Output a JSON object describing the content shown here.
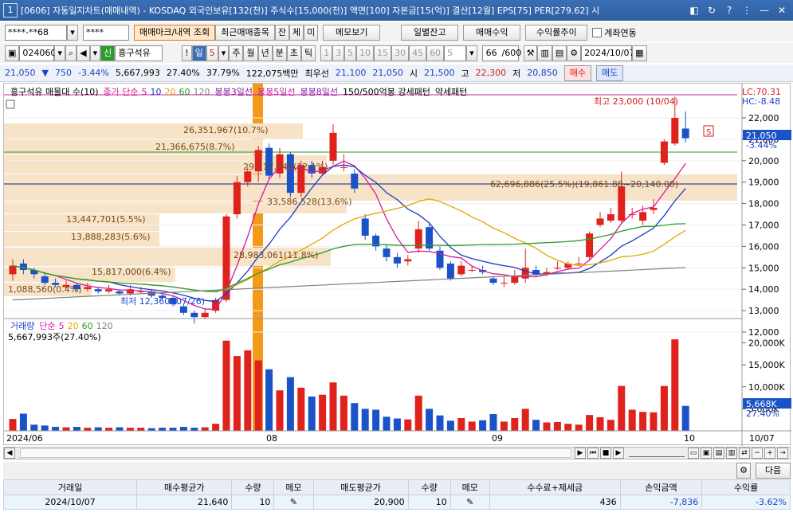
{
  "titlebar": {
    "number": "1",
    "title": "[0606] 자동일지차트(매매내역) - KOSDAQ 외국인보유[132(천)] 주식수[15,000(천)] 액면[100] 자본금[15(억)] 결산[12월] EPS[75] PER[279.62] 시",
    "controls": [
      "◧",
      "↻",
      "?",
      "⋮",
      "—",
      "✕"
    ]
  },
  "toolbar1": {
    "account_value": "****-**68",
    "password_value": "****",
    "btn_trade_marks": "매매마크/내역 조회",
    "btn_recent": "최근매매종목",
    "btn_jan": "잔",
    "btn_che": "체",
    "btn_mi": "미",
    "btn_memo": "메모보기",
    "btn_daily_balance": "일별잔고",
    "btn_trade_profit": "매매수익",
    "btn_return_trend": "수익률추이",
    "chk_account_link": "계좌연동"
  },
  "toolbar2": {
    "code": "024060",
    "credit_badge": "신",
    "stock_name": "흥구석유",
    "period_day": "일",
    "period_num": "5",
    "periods": [
      "주",
      "월",
      "년",
      "분",
      "초",
      "틱"
    ],
    "intervals": [
      "1",
      "3",
      "5",
      "10",
      "15",
      "30",
      "45",
      "60"
    ],
    "interval_sel": "5",
    "count": "66",
    "count_total": "/600",
    "date": "2024/10/07"
  },
  "quote": {
    "price": "21,050",
    "change": "750",
    "change_pct": "-3.44%",
    "volume": "5,667,993",
    "turnover_pct": "27.40%",
    "ratio": "37.79%",
    "amount": "122,075백만",
    "best_price_label": "최우선",
    "best_ask": "21,100",
    "best_bid": "21,050",
    "open_label": "시",
    "open": "21,500",
    "high_label": "고",
    "high": "22,300",
    "low_label": "저",
    "low": "20,850",
    "btn_buy": "매수",
    "btn_sell": "매도"
  },
  "chart_legend": {
    "stock_title": "흥구석유 매물대 수(10)",
    "ma_label": "종가 단순",
    "ma_periods": [
      "5",
      "10",
      "20",
      "60",
      "120"
    ],
    "ma_colors": [
      "#d61a9a",
      "#1a3ac8",
      "#e0a800",
      "#2a9a2a",
      "#808080"
    ],
    "pattern1": "봉봉3일선",
    "pattern2": "봉봉5일선",
    "pattern3": "봉봉8일선",
    "pattern4": "150/500억봉 강세패턴",
    "pattern5": "약세패턴",
    "lc": "LC:70.31",
    "hc": "HC:-8.48"
  },
  "volume_profile_labels": [
    "26,351,967(10.7%)",
    "21,366,675(8.7%)",
    "29,717,540(12.1%)",
    "62,696,886(25.5%)(19,861.88~20,140.00)",
    "33,586,528(13.6%)",
    "13,447,701(5.5%)",
    "13,888,283(5.6%)",
    "28,983,061(11.8%)",
    "15,817,000(6.4%)",
    "1,088,560(0.4%)"
  ],
  "price_annotations": {
    "high_note": "최고 23,000 (10/04)",
    "low_note": "최저 12,360 (07/26)",
    "sell_marker": "S"
  },
  "price_axis": [
    "22,000",
    "21,000",
    "20,000",
    "19,000",
    "18,000",
    "17,000",
    "16,000",
    "15,000",
    "14,000",
    "13,000",
    "12,000"
  ],
  "current_price_tag": "21,050",
  "current_change_tag": "-3.44%",
  "volume_legend": {
    "title": "거래량",
    "ma_label": "단순",
    "ma_periods": [
      "5",
      "20",
      "60",
      "120"
    ],
    "summary": "5,667,993주(27.40%)"
  },
  "volume_axis": [
    "20,000K",
    "15,000K",
    "10,000K",
    "5,000K"
  ],
  "volume_tag": "5,668K",
  "volume_pct_tag": "27.40%",
  "x_axis": [
    "2024/06",
    "08",
    "09",
    "10",
    "10/07"
  ],
  "bottom": {
    "next_btn": "다음"
  },
  "trade_table": {
    "headers": [
      "거래일",
      "매수평균가",
      "수량",
      "메모",
      "매도평균가",
      "수량",
      "메모",
      "수수료+제세금",
      "손익금액",
      "수익률"
    ],
    "rows": [
      [
        "2024/10/07",
        "21,640",
        "10",
        "",
        "20,900",
        "10",
        "",
        "436",
        "-7,836",
        "-3.62%"
      ]
    ]
  },
  "colors": {
    "up": "#e0221c",
    "down": "#1a52c8",
    "accent": "#f39a1a",
    "profile": "#f6e3c8"
  }
}
